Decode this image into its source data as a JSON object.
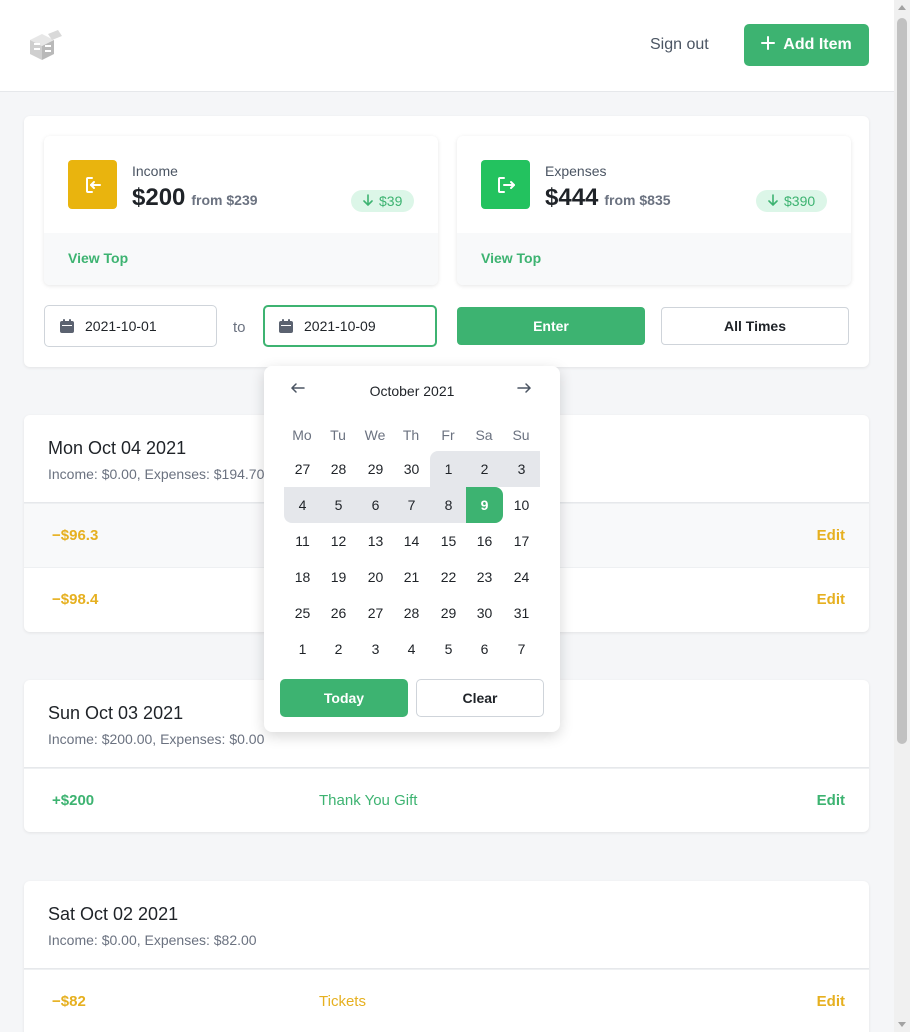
{
  "header": {
    "signout_label": "Sign out",
    "add_item_label": "Add Item"
  },
  "colors": {
    "accent": "#3db371",
    "income_icon_bg": "#e9b40e",
    "expense_icon_bg": "#23c25f",
    "negative": "#e6b020"
  },
  "summary": {
    "income": {
      "label": "Income",
      "amount": "$200",
      "from": "from $239",
      "change": "$39",
      "link": "View Top"
    },
    "expenses": {
      "label": "Expenses",
      "amount": "$444",
      "from": "from $835",
      "change": "$390",
      "link": "View Top"
    }
  },
  "filter": {
    "start_date": "2021-10-01",
    "to_label": "to",
    "end_date": "2021-10-09",
    "enter_label": "Enter",
    "all_times_label": "All Times"
  },
  "datepicker": {
    "month_label": "October 2021",
    "weekdays": [
      "Mo",
      "Tu",
      "We",
      "Th",
      "Fr",
      "Sa",
      "Su"
    ],
    "weeks": [
      [
        "27",
        "28",
        "29",
        "30",
        "1",
        "2",
        "3"
      ],
      [
        "4",
        "5",
        "6",
        "7",
        "8",
        "9",
        "10"
      ],
      [
        "11",
        "12",
        "13",
        "14",
        "15",
        "16",
        "17"
      ],
      [
        "18",
        "19",
        "20",
        "21",
        "22",
        "23",
        "24"
      ],
      [
        "25",
        "26",
        "27",
        "28",
        "29",
        "30",
        "31"
      ],
      [
        "1",
        "2",
        "3",
        "4",
        "5",
        "6",
        "7"
      ]
    ],
    "today_label": "Today",
    "clear_label": "Clear"
  },
  "days": [
    {
      "title": "Mon Oct 04 2021",
      "subtitle": "Income: $0.00, Expenses: $194.70",
      "rows": [
        {
          "amount": "−$96.3",
          "note": "",
          "edit": "Edit"
        },
        {
          "amount": "−$98.4",
          "note": "",
          "edit": "Edit"
        }
      ]
    },
    {
      "title": "Sun Oct 03 2021",
      "subtitle": "Income: $200.00, Expenses: $0.00",
      "rows": [
        {
          "amount": "+$200",
          "note": "Thank You Gift",
          "edit": "Edit"
        }
      ]
    },
    {
      "title": "Sat Oct 02 2021",
      "subtitle": "Income: $0.00, Expenses: $82.00",
      "rows": [
        {
          "amount": "−$82",
          "note": "Tickets",
          "edit": "Edit"
        }
      ]
    }
  ]
}
